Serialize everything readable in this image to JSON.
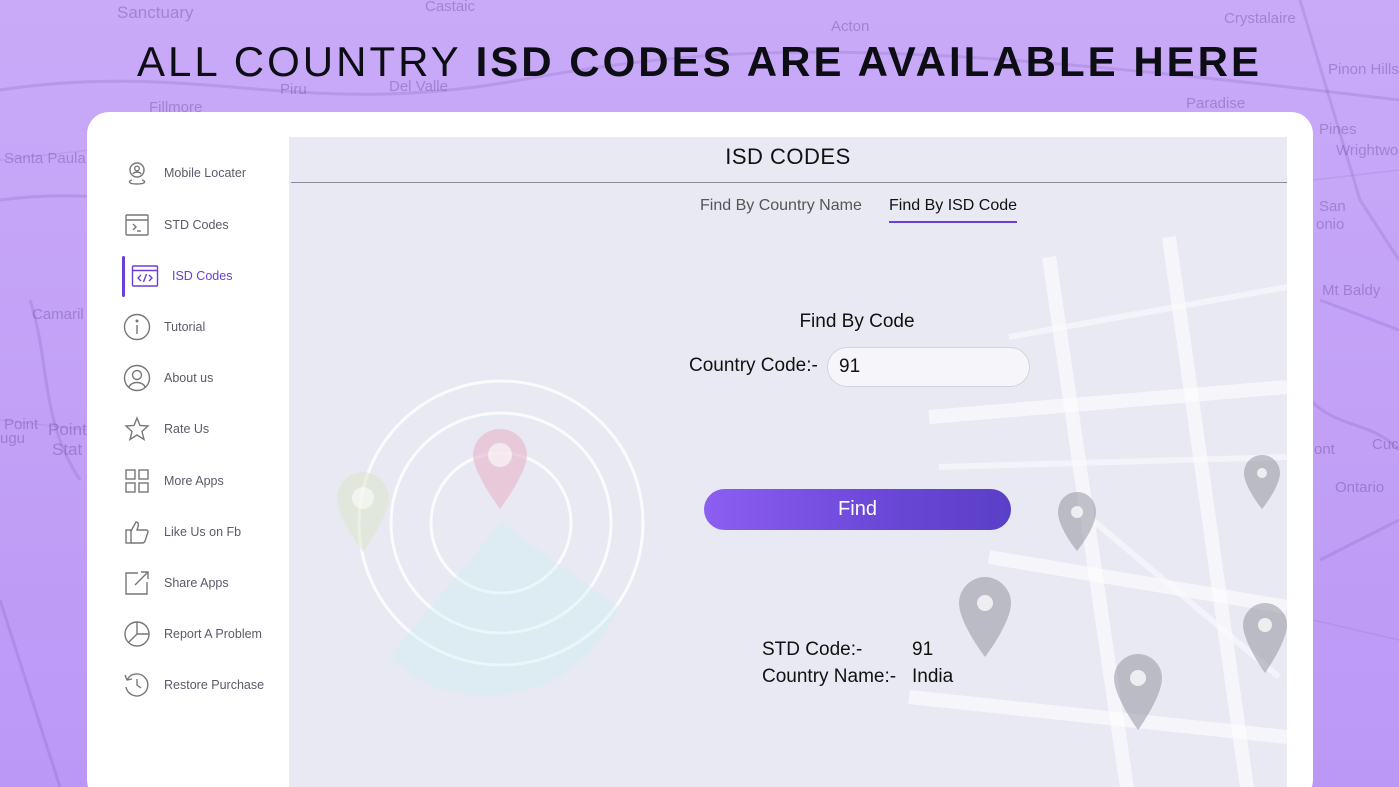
{
  "headline": {
    "light": "ALL COUNTRY",
    "bold": "ISD CODES ARE AVAILABLE HERE"
  },
  "background_map_labels": [
    "Sanctuary",
    "Castaic",
    "Acton",
    "Crystalaire",
    "Pinon Hills",
    "Piru",
    "Del Valle",
    "Fillmore",
    "Paradise",
    "Santa Paula",
    "Pines",
    "Wrightwo",
    "San",
    "onio",
    "Mt Baldy",
    "Camaril",
    "Point",
    "Point",
    "ugu",
    "Stat",
    "Ontario",
    "ont",
    "Cuc"
  ],
  "sidebar": {
    "items": [
      {
        "label": "Mobile Locater",
        "icon": "location-person-icon"
      },
      {
        "label": "STD Codes",
        "icon": "terminal-window-icon"
      },
      {
        "label": "ISD Codes",
        "icon": "code-window-icon",
        "active": true
      },
      {
        "label": "Tutorial",
        "icon": "info-icon"
      },
      {
        "label": "About us",
        "icon": "user-circle-icon"
      },
      {
        "label": "Rate Us",
        "icon": "star-icon"
      },
      {
        "label": "More Apps",
        "icon": "grid-icon"
      },
      {
        "label": "Like Us on Fb",
        "icon": "thumbs-up-icon"
      },
      {
        "label": "Share Apps",
        "icon": "share-icon"
      },
      {
        "label": "Report A Problem",
        "icon": "pie-chart-icon"
      },
      {
        "label": "Restore Purchase",
        "icon": "history-icon"
      }
    ]
  },
  "panel": {
    "title": "ISD CODES",
    "tabs": [
      {
        "label": "Find By Country Name",
        "active": false
      },
      {
        "label": "Find By ISD Code",
        "active": true
      }
    ],
    "find_title": "Find By Code",
    "country_code_label": "Country Code:-",
    "country_code_value": "91",
    "find_button": "Find",
    "results": [
      {
        "key": "STD Code:-",
        "value": "91"
      },
      {
        "key": "Country Name:-",
        "value": "India"
      }
    ]
  },
  "colors": {
    "accent": "#6a3fd6",
    "background": "#c5a6f7",
    "panel": "#e9e9f4"
  }
}
